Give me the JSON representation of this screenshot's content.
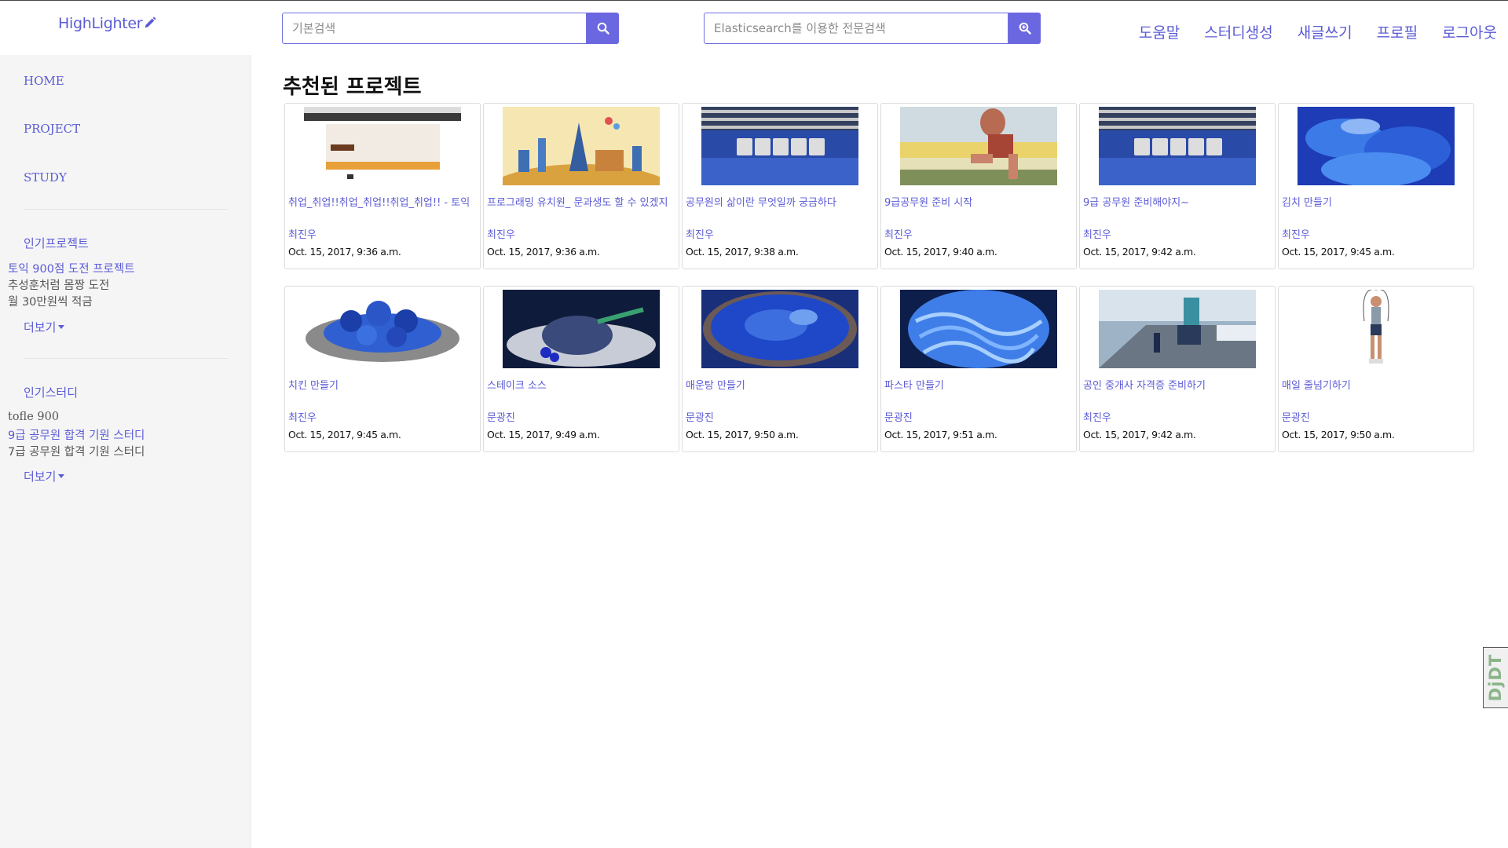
{
  "header": {
    "logo": "HighLighter",
    "search_basic_placeholder": "기본검색",
    "search_full_placeholder": "Elasticsearch를 이용한 전문검색",
    "nav": [
      "도움말",
      "스터디생성",
      "새글쓰기",
      "프로필",
      "로그아웃"
    ]
  },
  "sidebar": {
    "links": [
      "HOME",
      "PROJECT",
      "STUDY"
    ],
    "popular_projects_heading": "인기프로젝트",
    "popular_projects": [
      "토익 900점 도전 프로젝트",
      "추성훈처럼 몸짱 도전",
      "월 30만원씩 적금"
    ],
    "popular_studies_heading": "인기스터디",
    "popular_studies": [
      "tofle 900",
      "9급 공무원 합격 기원 스터디",
      "7급 공무원 합격 기원 스터디"
    ],
    "more_label": "더보기"
  },
  "main": {
    "title": "추천된 프로젝트",
    "cards": [
      {
        "title": "취업_취업!!취업_취업!!취업_취업!! - 토익",
        "author": "최진우",
        "date": "Oct. 15, 2017, 9:36 a.m.",
        "thumb": "screenshot"
      },
      {
        "title": "프로그래밍 유치원_ 문과생도 할 수 있겠지",
        "author": "최진우",
        "date": "Oct. 15, 2017, 9:36 a.m.",
        "thumb": "travel"
      },
      {
        "title": "공무원의 삶이란 무엇일까 궁금하다",
        "author": "최진우",
        "date": "Oct. 15, 2017, 9:38 a.m.",
        "thumb": "study"
      },
      {
        "title": "9급공무원 준비 시작",
        "author": "최진우",
        "date": "Oct. 15, 2017, 9:40 a.m.",
        "thumb": "runner"
      },
      {
        "title": "9급 공무원 준비해야지~",
        "author": "최진우",
        "date": "Oct. 15, 2017, 9:42 a.m.",
        "thumb": "study"
      },
      {
        "title": "김치 만들기",
        "author": "최진우",
        "date": "Oct. 15, 2017, 9:45 a.m.",
        "thumb": "kimchi"
      },
      {
        "title": "치킨 만들기",
        "author": "최진우",
        "date": "Oct. 15, 2017, 9:45 a.m.",
        "thumb": "chicken"
      },
      {
        "title": "스테이크 소스",
        "author": "문광진",
        "date": "Oct. 15, 2017, 9:49 a.m.",
        "thumb": "steak"
      },
      {
        "title": "매운탕 만들기",
        "author": "문광진",
        "date": "Oct. 15, 2017, 9:50 a.m.",
        "thumb": "stew"
      },
      {
        "title": "파스타 만들기",
        "author": "문광진",
        "date": "Oct. 15, 2017, 9:51 a.m.",
        "thumb": "pasta"
      },
      {
        "title": "공인 중개사 자격증 준비하기",
        "author": "최진우",
        "date": "Oct. 15, 2017, 9:42 a.m.",
        "thumb": "runners"
      },
      {
        "title": "매일 줄넘기하기",
        "author": "문광진",
        "date": "Oct. 15, 2017, 9:50 a.m.",
        "thumb": "jumprope"
      }
    ]
  },
  "widget": {
    "ddt_label": "DjDT"
  },
  "colors": {
    "accent": "#5b5bd6",
    "button": "#6b67e0",
    "sidebar_bg": "#f5f5f5"
  }
}
